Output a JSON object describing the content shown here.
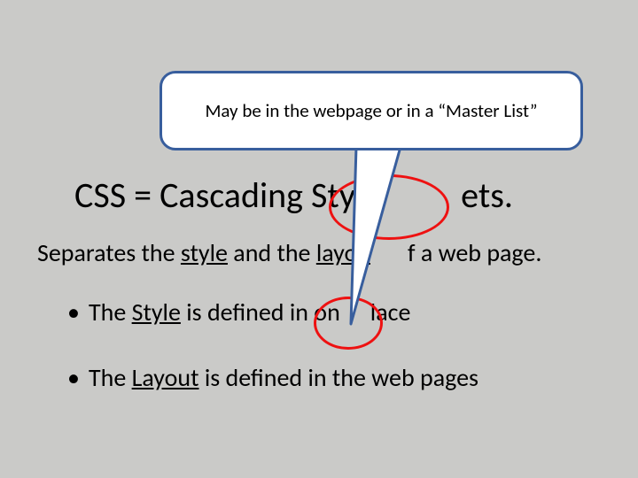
{
  "callout": {
    "text": "May be in the webpage or in a “Master List”"
  },
  "heading": {
    "prefix": "CSS  = Cascading Styl",
    "suffix": "ets."
  },
  "subheading": {
    "p1": "Separates the ",
    "u1": "style",
    "p2": " and the ",
    "u2": "layou",
    "p3": "f a web page."
  },
  "bullets": [
    {
      "p1": "The ",
      "u1": "Style",
      "p2": " is defined in on",
      "p3": "lace"
    },
    {
      "p1": "The ",
      "u1": "Layout",
      "p2": " is defined in the web pages",
      "p3": ""
    }
  ],
  "glyphs": {
    "bullet": "•"
  },
  "colors": {
    "callout_border": "#385e9d",
    "annotation_red": "#e11",
    "slide_bg": "#cacac8"
  }
}
